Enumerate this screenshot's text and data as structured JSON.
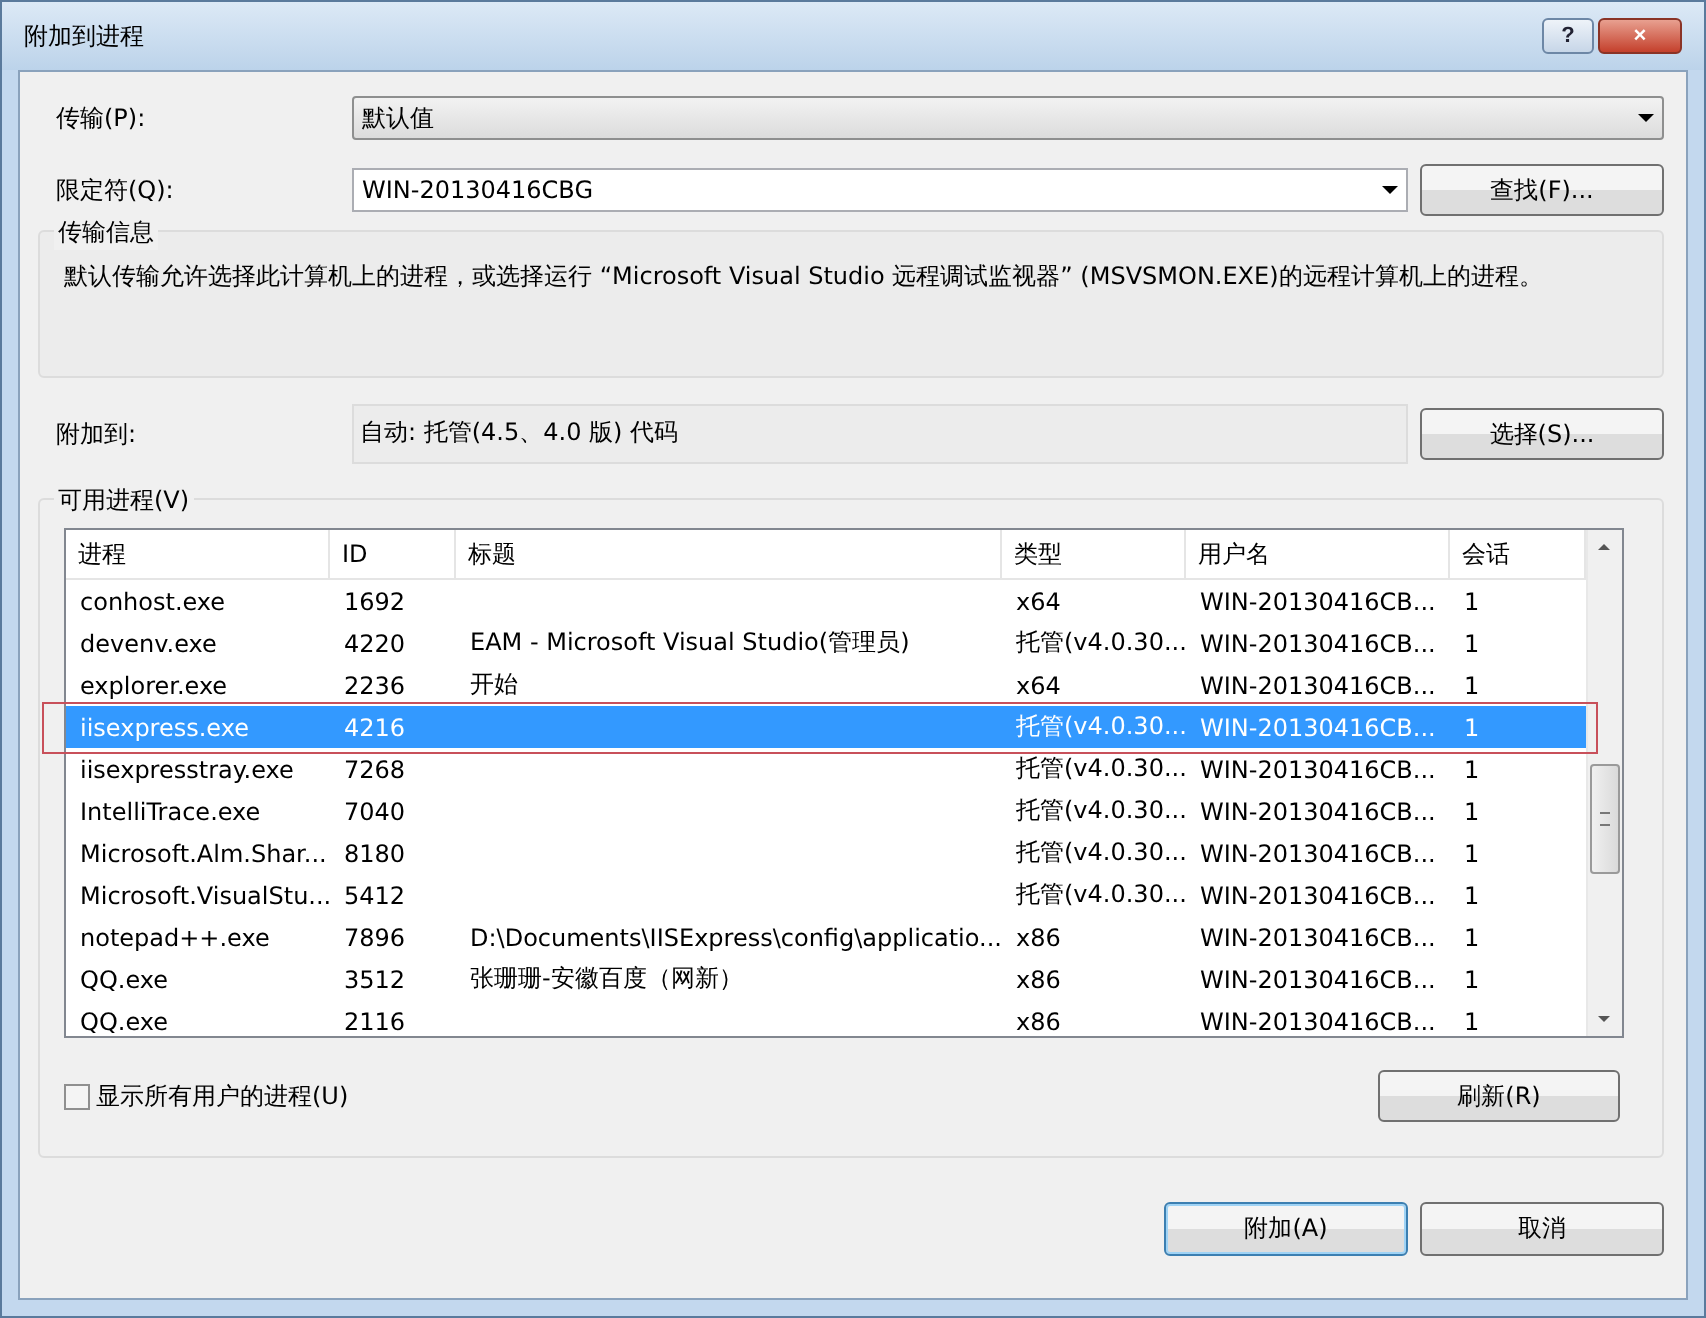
{
  "window": {
    "title": "附加到进程",
    "buttons": [
      "?",
      "×"
    ]
  },
  "transport": {
    "label": "传输(P):",
    "value": "默认值"
  },
  "qualifier": {
    "label": "限定符(Q):",
    "value": "WIN-20130416CBG",
    "button": "查找(F)..."
  },
  "transport_info": {
    "title": "传输信息",
    "text": "默认传输允许选择此计算机上的进程，或选择运行 “Microsoft Visual Studio 远程调试监视器” (MSVSMON.EXE)的远程计算机上的进程。"
  },
  "attach_to": {
    "label": "附加到:",
    "value": "自动: 托管(4.5、4.0 版) 代码",
    "button": "选择(S)..."
  },
  "processes": {
    "title": "可用进程(V)",
    "columns": [
      "进程",
      "ID",
      "标题",
      "类型",
      "用户名",
      "会话"
    ],
    "rows": [
      {
        "cells": [
          "conhost.exe",
          "1692",
          "",
          "x64",
          "WIN-20130416CB...",
          "1"
        ],
        "selected": false,
        "outlined": false
      },
      {
        "cells": [
          "devenv.exe",
          "4220",
          "EAM - Microsoft Visual Studio(管理员)",
          "托管(v4.0.30...",
          "WIN-20130416CB...",
          "1"
        ],
        "selected": false,
        "outlined": false
      },
      {
        "cells": [
          "explorer.exe",
          "2236",
          "开始",
          "x64",
          "WIN-20130416CB...",
          "1"
        ],
        "selected": false,
        "outlined": false
      },
      {
        "cells": [
          "iisexpress.exe",
          "4216",
          "",
          "托管(v4.0.30...",
          "WIN-20130416CB...",
          "1"
        ],
        "selected": true,
        "outlined": true
      },
      {
        "cells": [
          "iisexpresstray.exe",
          "7268",
          "",
          "托管(v4.0.30...",
          "WIN-20130416CB...",
          "1"
        ],
        "selected": false,
        "outlined": false
      },
      {
        "cells": [
          "IntelliTrace.exe",
          "7040",
          "",
          "托管(v4.0.30...",
          "WIN-20130416CB...",
          "1"
        ],
        "selected": false,
        "outlined": false
      },
      {
        "cells": [
          "Microsoft.Alm.Shar...",
          "8180",
          "",
          "托管(v4.0.30...",
          "WIN-20130416CB...",
          "1"
        ],
        "selected": false,
        "outlined": false
      },
      {
        "cells": [
          "Microsoft.VisualStu...",
          "5412",
          "",
          "托管(v4.0.30...",
          "WIN-20130416CB...",
          "1"
        ],
        "selected": false,
        "outlined": false
      },
      {
        "cells": [
          "notepad++.exe",
          "7896",
          "D:\\Documents\\IISExpress\\config\\applicatio...",
          "x86",
          "WIN-20130416CB...",
          "1"
        ],
        "selected": false,
        "outlined": false
      },
      {
        "cells": [
          "QQ.exe",
          "3512",
          "张珊珊-安徽百度（网新）",
          "x86",
          "WIN-20130416CB...",
          "1"
        ],
        "selected": false,
        "outlined": false
      },
      {
        "cells": [
          "QQ.exe",
          "2116",
          "",
          "x86",
          "WIN-20130416CB...",
          "1"
        ],
        "selected": false,
        "outlined": false
      }
    ],
    "show_all_users": {
      "label": "显示所有用户的进程(U)",
      "checked": false
    },
    "refresh_button": "刷新(R)"
  },
  "footer_buttons": [
    {
      "label": "附加(A)",
      "default": true
    },
    {
      "label": "取消",
      "default": false
    }
  ]
}
